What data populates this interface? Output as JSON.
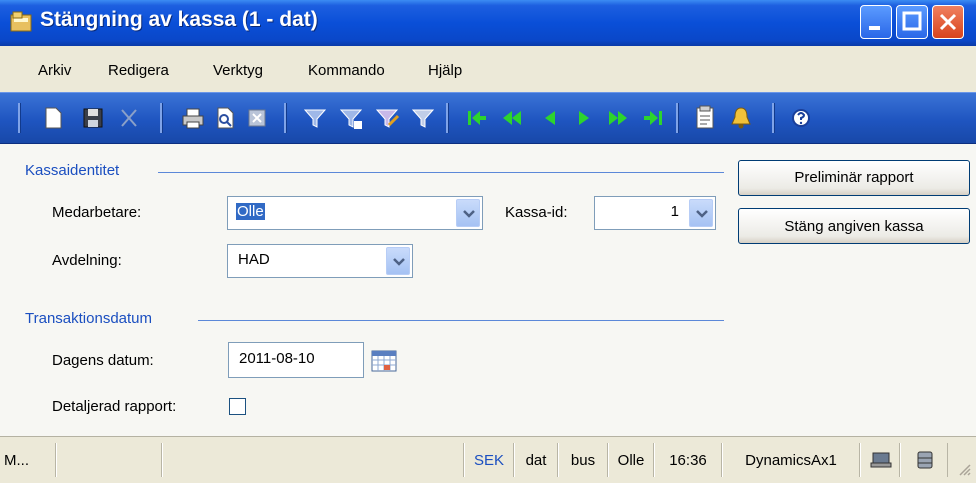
{
  "window": {
    "title": "Stängning av kassa (1 - dat)"
  },
  "menu": {
    "items": [
      "Arkiv",
      "Redigera",
      "Verktyg",
      "Kommando",
      "Hjälp"
    ]
  },
  "groups": {
    "kassaidentitet": "Kassaidentitet",
    "transaktionsdatum": "Transaktionsdatum"
  },
  "fields": {
    "medarbetare": {
      "label": "Medarbetare:",
      "value": "Olle"
    },
    "kassa_id": {
      "label": "Kassa-id:",
      "value": "1"
    },
    "avdelning": {
      "label": "Avdelning:",
      "value": "HAD"
    },
    "dagens_datum": {
      "label": "Dagens datum:",
      "value": "2011-08-10"
    },
    "detaljerad_rapport": {
      "label": "Detaljerad rapport:",
      "checked": false
    }
  },
  "buttons": {
    "preliminar_rapport": "Preliminär rapport",
    "stang_kassa": "Stäng angiven kassa"
  },
  "statusbar": {
    "message": "M...",
    "currency": "SEK",
    "company": "dat",
    "layer": "bus",
    "user": "Olle",
    "time": "16:36",
    "server": "DynamicsAx1"
  },
  "colors": {
    "title_bar": "#0a4fd8",
    "toolbar": "#1f55c0",
    "group_label": "#1b4fc0",
    "currency_text": "#1b4fc0"
  }
}
